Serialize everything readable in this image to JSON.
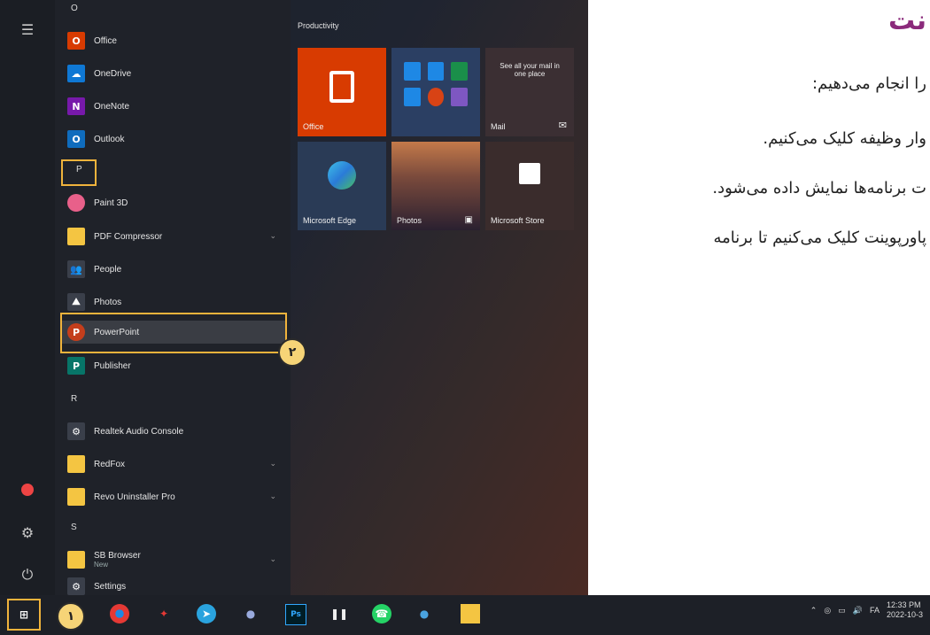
{
  "document": {
    "title": "نت",
    "lines": [
      "را انجام می‌دهیم:",
      "وار وظیفه کلیک می‌کنیم.",
      "ت برنامه‌ها نمایش داده می‌شود.",
      "پاورپوینت کلیک می‌کنیم تا برنامه"
    ]
  },
  "start_menu": {
    "top_letter": "O",
    "apps": [
      {
        "label": "Office",
        "icon": "office-icon",
        "color": "#d83b01"
      },
      {
        "label": "OneDrive",
        "icon": "onedrive-icon",
        "color": "#0f78d4"
      },
      {
        "label": "OneNote",
        "icon": "onenote-icon",
        "color": "#7719aa"
      },
      {
        "label": "Outlook",
        "icon": "outlook-icon",
        "color": "#0f6cbd"
      },
      {
        "label": "P",
        "type": "letter"
      },
      {
        "label": "Paint 3D",
        "icon": "paint3d-icon",
        "color": "#e8608a"
      },
      {
        "label": "PDF Compressor",
        "icon": "folder-icon",
        "color": "#f4c542",
        "expandable": true
      },
      {
        "label": "People",
        "icon": "people-icon",
        "color": "#3a3f4a"
      },
      {
        "label": "Photos",
        "icon": "photos-icon",
        "color": "#3a3f4a"
      },
      {
        "label": "PowerPoint",
        "icon": "powerpoint-icon",
        "color": "#c43e1c"
      },
      {
        "label": "Publisher",
        "icon": "publisher-icon",
        "color": "#077568"
      },
      {
        "label": "R",
        "type": "letter"
      },
      {
        "label": "Realtek Audio Console",
        "icon": "realtek-icon",
        "color": "#3a3f4a"
      },
      {
        "label": "RedFox",
        "icon": "folder-icon",
        "color": "#f4c542",
        "expandable": true
      },
      {
        "label": "Revo Uninstaller Pro",
        "icon": "folder-icon",
        "color": "#f4c542",
        "expandable": true
      },
      {
        "label": "S",
        "type": "letter"
      },
      {
        "label": "SB Browser",
        "sublabel": "New",
        "icon": "folder-icon",
        "color": "#f4c542",
        "expandable": true
      },
      {
        "label": "Settings",
        "icon": "gear-icon",
        "color": "#3a3f4a"
      }
    ],
    "tiles_heading": "Productivity",
    "tiles": [
      {
        "label": "Office",
        "color": "#d83b01"
      },
      {
        "label": "",
        "color": "#2b3f63"
      },
      {
        "label": "Mail",
        "text": "See all your mail in one place",
        "color": "#3b2f33"
      },
      {
        "label": "Microsoft Edge",
        "color": "#2a3b56"
      },
      {
        "label": "Photos",
        "color": "#7a4a3c"
      },
      {
        "label": "Microsoft Store",
        "color": "#3a2c2c"
      }
    ]
  },
  "steps": {
    "one": "١",
    "two": "٢"
  },
  "taskbar": {
    "tray_lang": "FA",
    "tray_time": "12:33 PM",
    "tray_date": "2022-10-3",
    "ps_label": "Ps"
  }
}
